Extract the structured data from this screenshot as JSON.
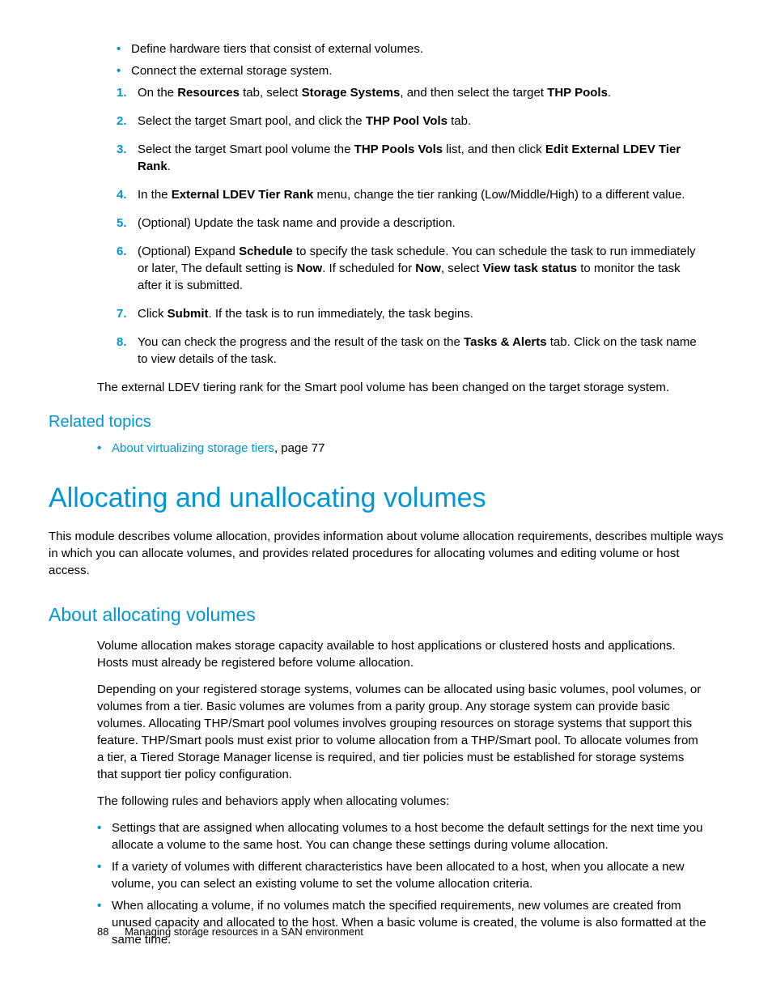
{
  "prelist": {
    "bullets": [
      "Define hardware tiers that consist of external volumes.",
      "Connect the external storage system."
    ],
    "steps": [
      {
        "pre": "On the ",
        "b1": "Resources",
        "mid1": " tab, select ",
        "b2": "Storage Systems",
        "mid2": ", and then select the target ",
        "b3": "THP Pools",
        "post": "."
      },
      {
        "pre": "Select the target Smart pool, and click the ",
        "b1": "THP Pool Vols",
        "post": " tab."
      },
      {
        "pre": "Select the target Smart pool volume the ",
        "b1": "THP Pools Vols",
        "mid1": " list, and then click ",
        "b2": "Edit External LDEV Tier Rank",
        "post": "."
      },
      {
        "pre": "In the ",
        "b1": "External LDEV Tier Rank",
        "post": " menu, change the tier ranking (Low/Middle/High) to a different value."
      },
      {
        "pre": "(Optional) Update the task name and provide a description."
      },
      {
        "pre": "(Optional) Expand ",
        "b1": "Schedule",
        "mid1": " to specify the task schedule. You can schedule the task to run immediately or later, The default setting is ",
        "b2": "Now",
        "mid2": ". If scheduled for ",
        "b3": "Now",
        "mid3": ", select ",
        "b4": "View task status",
        "post": " to monitor the task after it is submitted."
      },
      {
        "pre": "Click ",
        "b1": "Submit",
        "post": ". If the task is to run immediately, the task begins."
      },
      {
        "pre": "You can check the progress and the result of the task on the ",
        "b1": "Tasks & Alerts",
        "post": " tab. Click on the task name to view details of the task."
      }
    ],
    "closing": "The external LDEV tiering rank for the Smart pool volume has been changed on the target storage system."
  },
  "related": {
    "heading": "Related topics",
    "link_text": "About virtualizing storage tiers",
    "link_suffix": ", page 77"
  },
  "h1": "Allocating and unallocating volumes",
  "intro": "This module describes volume allocation, provides information about volume allocation requirements, describes multiple ways in which you can allocate volumes, and provides related procedures for allocating volumes and editing volume or host access.",
  "h2": "About allocating volumes",
  "alloc": {
    "p1": "Volume allocation makes storage capacity available to host applications or clustered hosts and applications. Hosts must already be registered before volume allocation.",
    "p2": "Depending on your registered storage systems, volumes can be allocated using basic volumes, pool volumes, or volumes from a tier. Basic volumes are volumes from a parity group. Any storage system can provide basic volumes. Allocating THP/Smart pool volumes involves grouping resources on storage systems that support this feature. THP/Smart pools must exist prior to volume allocation from a THP/Smart pool. To allocate volumes from a tier, a Tiered Storage Manager license is required, and tier policies must be established for storage systems that support tier policy configuration.",
    "p3": "The following rules and behaviors apply when allocating volumes:",
    "bullets": [
      "Settings that are assigned when allocating volumes to a host become the default settings for the next time you allocate a volume to the same host. You can change these settings during volume allocation.",
      "If a variety of volumes with different characteristics have been allocated to a host, when you allocate a new volume, you can select an existing volume to set the volume allocation criteria.",
      "When allocating a volume, if no volumes match the specified requirements, new volumes are created from unused capacity and allocated to the host. When a basic volume is created, the volume is also formatted at the same time."
    ]
  },
  "footer": {
    "page": "88",
    "title": "Managing storage resources in a SAN environment"
  }
}
